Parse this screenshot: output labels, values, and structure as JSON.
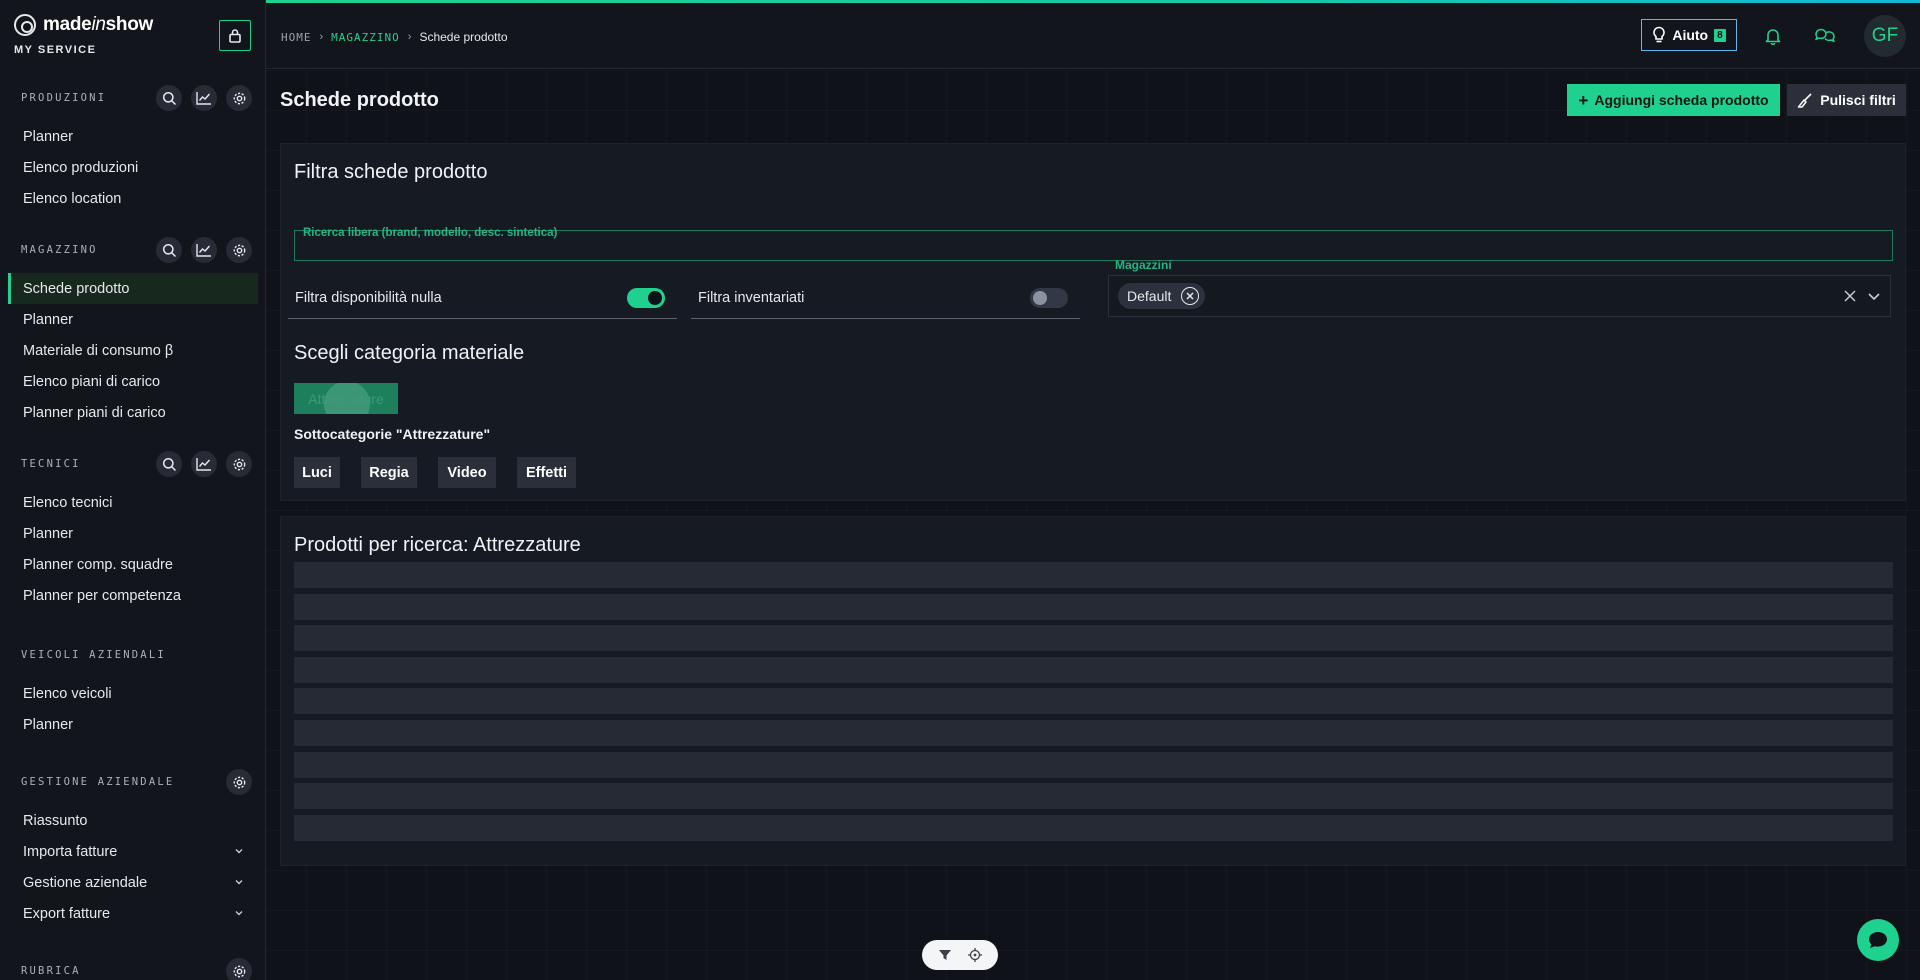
{
  "brand": {
    "name_pre": "made",
    "name_mid": "in",
    "name_post": "show",
    "subtitle": "MY SERVICE"
  },
  "sidebar": {
    "sections": [
      {
        "label": "PRODUZIONI",
        "items": [
          "Planner",
          "Elenco produzioni",
          "Elenco location"
        ]
      },
      {
        "label": "MAGAZZINO",
        "items": [
          "Schede prodotto",
          "Planner",
          "Materiale di consumo β",
          "Elenco piani di carico",
          "Planner piani di carico"
        ]
      },
      {
        "label": "TECNICI",
        "items": [
          "Elenco tecnici",
          "Planner",
          "Planner comp. squadre",
          "Planner per competenza"
        ]
      },
      {
        "label": "VEICOLI AZIENDALI",
        "items": [
          "Elenco veicoli",
          "Planner"
        ]
      },
      {
        "label": "GESTIONE AZIENDALE",
        "items": [
          "Riassunto",
          "Importa fatture",
          "Gestione aziendale",
          "Export fatture"
        ]
      },
      {
        "label": "RUBRICA",
        "items": []
      }
    ]
  },
  "breadcrumb": {
    "home": "HOME",
    "section": "MAGAZZINO",
    "current": "Schede prodotto"
  },
  "topbar": {
    "help_label": "Aiuto",
    "help_badge": "8",
    "avatar_initials": "GF"
  },
  "page": {
    "title": "Schede prodotto",
    "add_button": "Aggiungi scheda prodotto",
    "clear_button": "Pulisci filtri"
  },
  "filters": {
    "title": "Filtra schede prodotto",
    "search_label": "Ricerca libera (brand, modello, desc. sintetica)",
    "search_value": "",
    "toggle_null_label": "Filtra disponibilità nulla",
    "toggle_null_on": true,
    "toggle_inv_label": "Filtra inventariati",
    "toggle_inv_on": false,
    "warehouses_label": "Magazzini",
    "warehouse_chip": "Default",
    "category_title": "Scegli categoria materiale",
    "category_selected": "Attrezzature",
    "subcategory_title": "Sottocategorie \"Attrezzature\"",
    "subcategories": [
      "Luci",
      "Regia",
      "Video",
      "Effetti"
    ]
  },
  "results": {
    "title": "Prodotti per ricerca: Attrezzature",
    "loading_rows": 9
  },
  "colors": {
    "accent": "#1fd18f",
    "background": "#0f1218",
    "panel": "#161a22"
  }
}
